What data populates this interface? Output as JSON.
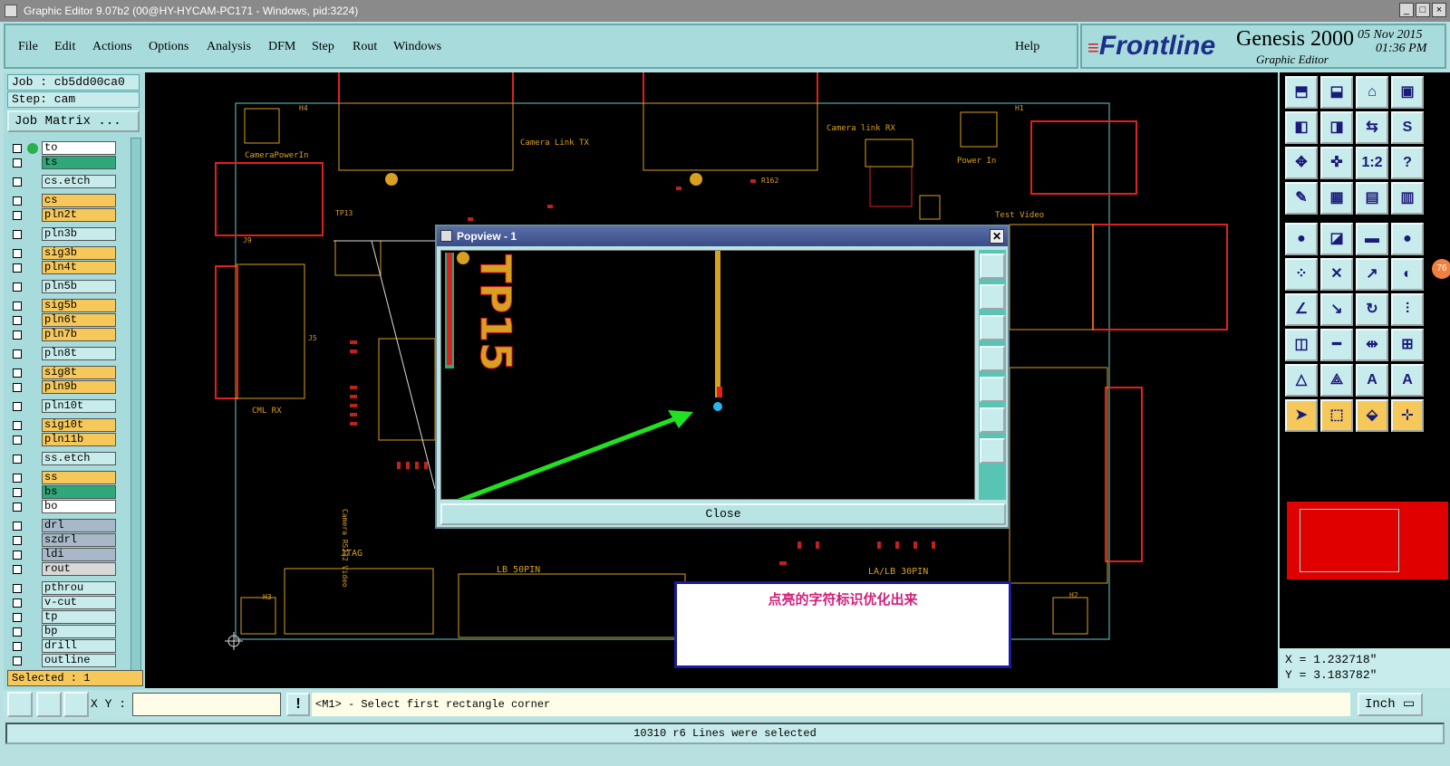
{
  "window": {
    "title": "Graphic Editor 9.07b2 (00@HY-HYCAM-PC171 - Windows, pid:3224)"
  },
  "menu": {
    "items": [
      {
        "label": "File"
      },
      {
        "label": "Edit"
      },
      {
        "label": "Actions"
      },
      {
        "label": "Options"
      },
      {
        "label": "Analysis"
      },
      {
        "label": "DFM"
      },
      {
        "label": "Step"
      },
      {
        "label": "Rout"
      },
      {
        "label": "Windows"
      }
    ],
    "help": "Help"
  },
  "brand": {
    "logo": "Frontline",
    "product": "Genesis 2000",
    "subtitle": "Graphic Editor",
    "date": "05 Nov 2015",
    "time": "01:36 PM"
  },
  "job": {
    "job_label": "Job : cb5dd00ca0",
    "step_label": "Step: cam",
    "matrix_button": "Job Matrix ..."
  },
  "layers": [
    {
      "name": "to",
      "color": "#ffffff",
      "active": true
    },
    {
      "name": "ts",
      "color": "#2ea87a"
    },
    {
      "name": "cs.etch",
      "color": "#c8ecec"
    },
    {
      "name": "cs",
      "color": "#f6c85a"
    },
    {
      "name": "pln2t",
      "color": "#f6c85a"
    },
    {
      "name": "pln3b",
      "color": "#c8ecec"
    },
    {
      "name": "sig3b",
      "color": "#f6c85a"
    },
    {
      "name": "pln4t",
      "color": "#f6c85a"
    },
    {
      "name": "pln5b",
      "color": "#c8ecec"
    },
    {
      "name": "sig5b",
      "color": "#f6c85a"
    },
    {
      "name": "pln6t",
      "color": "#f6c85a"
    },
    {
      "name": "pln7b",
      "color": "#f6c85a"
    },
    {
      "name": "pln8t",
      "color": "#c8ecec"
    },
    {
      "name": "sig8t",
      "color": "#f6c85a"
    },
    {
      "name": "pln9b",
      "color": "#f6c85a"
    },
    {
      "name": "pln10t",
      "color": "#c8ecec"
    },
    {
      "name": "sig10t",
      "color": "#f6c85a"
    },
    {
      "name": "pln11b",
      "color": "#f6c85a"
    },
    {
      "name": "ss.etch",
      "color": "#c8ecec"
    },
    {
      "name": "ss",
      "color": "#f6c85a"
    },
    {
      "name": "bs",
      "color": "#2ea87a"
    },
    {
      "name": "bo",
      "color": "#ffffff"
    },
    {
      "name": "drl",
      "color": "#a8b8c8"
    },
    {
      "name": "szdrl",
      "color": "#a8b8c8"
    },
    {
      "name": "ldi",
      "color": "#a8b8c8"
    },
    {
      "name": "rout",
      "color": "#d8d8d8"
    },
    {
      "name": "pthrou",
      "color": "#c8ecec"
    },
    {
      "name": "v-cut",
      "color": "#c8ecec"
    },
    {
      "name": "tp",
      "color": "#c8ecec"
    },
    {
      "name": "bp",
      "color": "#c8ecec"
    },
    {
      "name": "drill",
      "color": "#c8ecec"
    },
    {
      "name": "outline",
      "color": "#c8ecec"
    }
  ],
  "selected_label": "Selected : 1",
  "board_labels": {
    "camera_power": "CameraPowerIn",
    "camera_link_tx": "Camera Link TX",
    "camera_link_rx": "Camera link RX",
    "power_in": "Power In",
    "test_video": "Test Video",
    "tp13": "TP13",
    "tp15": "TP15",
    "cml_rx": "CML RX",
    "jtag": "JTAG",
    "lb50": "LB 50PIN",
    "la_lb": "LA/LB 30PIN",
    "h1": "H1",
    "h2": "H2",
    "h3": "H3",
    "h4": "H4",
    "j9": "J9",
    "j5": "J5",
    "r162": "R162",
    "camera_rs232": "Camera RS232 Video"
  },
  "popview": {
    "title": "Popview - 1",
    "close_button": "Close",
    "label": "TP15"
  },
  "annotation": {
    "text": "点亮的字符标识优化出来"
  },
  "coords": {
    "x": "X = 1.232718\"",
    "y": "Y = 3.183782\""
  },
  "command": {
    "xy_label": "X Y :",
    "xy_value": "",
    "warn": "!",
    "prompt": "<M1> - Select first rectangle corner",
    "units": "Inch"
  },
  "status": "10310 r6 Lines were selected",
  "badge": "76"
}
